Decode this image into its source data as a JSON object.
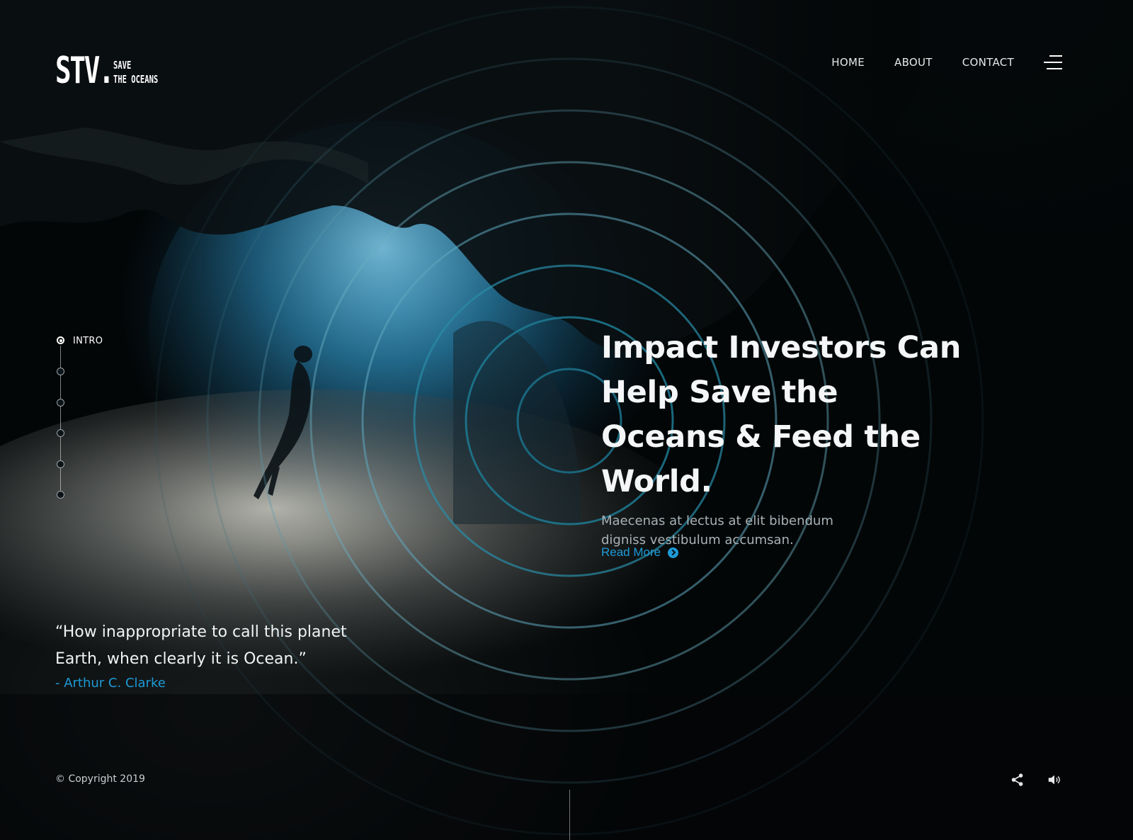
{
  "brand": {
    "mark": "STV.",
    "tagline_line1": "SAVE",
    "tagline_line2": "THE OCEANS"
  },
  "nav": {
    "items": [
      {
        "label": "HOME"
      },
      {
        "label": "ABOUT"
      },
      {
        "label": "CONTACT"
      }
    ],
    "menu_icon": "hamburger-menu-icon"
  },
  "side_nav": {
    "active_label": "INTRO",
    "total_steps": 6,
    "active_step": 1
  },
  "hero": {
    "title": "Impact Investors Can Help Save the Oceans & Feed the World.",
    "subtitle": "Maecenas at lectus at elit bibendum digniss vestibulum accumsan.",
    "cta_label": "Read More",
    "cta_icon": "arrow-circle-right-icon"
  },
  "quote": {
    "text": "“How inappropriate to call this planet Earth, when clearly it is Ocean.”",
    "author": "- Arthur C. Clarke"
  },
  "footer": {
    "copyright": "© Copyright 2019",
    "icons": [
      "share-icon",
      "volume-icon"
    ]
  },
  "colors": {
    "accent": "#1d9ad6",
    "background": "#030607",
    "text": "#ffffff"
  }
}
